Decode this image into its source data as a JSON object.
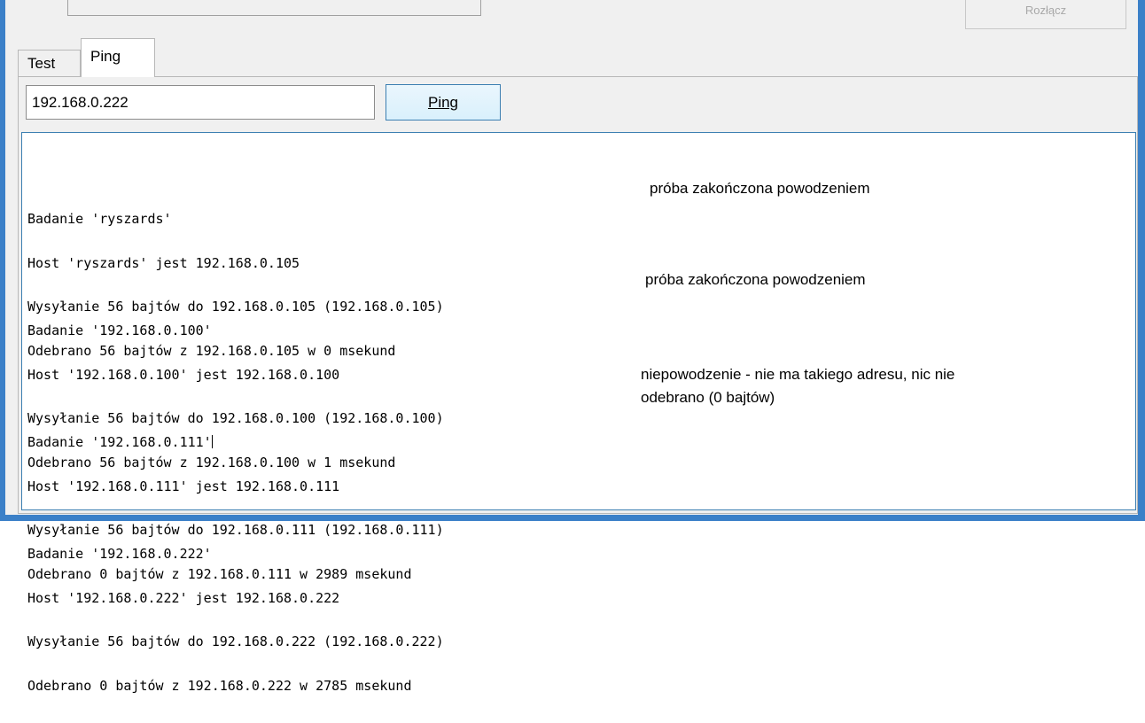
{
  "top": {
    "close_label": "Rozłącz"
  },
  "tabs": [
    {
      "label": "Test",
      "active": false
    },
    {
      "label": "Ping",
      "active": true
    }
  ],
  "ping_form": {
    "address_value": "192.168.0.222",
    "ping_button_label": "Ping"
  },
  "log": {
    "blocks": [
      {
        "lines": [
          "Badanie 'ryszards'",
          "Host 'ryszards' jest 192.168.0.105",
          "Wysyłanie 56 bajtów do 192.168.0.105 (192.168.0.105)",
          "Odebrano 56 bajtów z 192.168.0.105 w 0 msekund"
        ]
      },
      {
        "lines": [
          "Badanie '192.168.0.100'",
          "Host '192.168.0.100' jest 192.168.0.100",
          "Wysyłanie 56 bajtów do 192.168.0.100 (192.168.0.100)",
          "Odebrano 56 bajtów z 192.168.0.100 w 1 msekund"
        ]
      },
      {
        "lines": [
          "Badanie '192.168.0.111'",
          "Host '192.168.0.111' jest 192.168.0.111",
          "Wysyłanie 56 bajtów do 192.168.0.111 (192.168.0.111)",
          "Odebrano 0 bajtów z 192.168.0.111 w 2989 msekund"
        ]
      },
      {
        "lines": [
          "Badanie '192.168.0.222'",
          "Host '192.168.0.222' jest 192.168.0.222",
          "Wysyłanie 56 bajtów do 192.168.0.222 (192.168.0.222)",
          "Odebrano 0 bajtów z 192.168.0.222 w 2785 msekund"
        ]
      }
    ]
  },
  "annotations": {
    "note1": "próba zakończona powodzeniem",
    "note2": "próba zakończona powodzeniem",
    "note3_line1": "niepowodzenie - nie ma takiego adresu, nic nie",
    "note3_line2": "odebrano (0 bajtów)"
  },
  "colors": {
    "window_frame": "#3b80c8",
    "focus_border": "#3c7fb1"
  }
}
